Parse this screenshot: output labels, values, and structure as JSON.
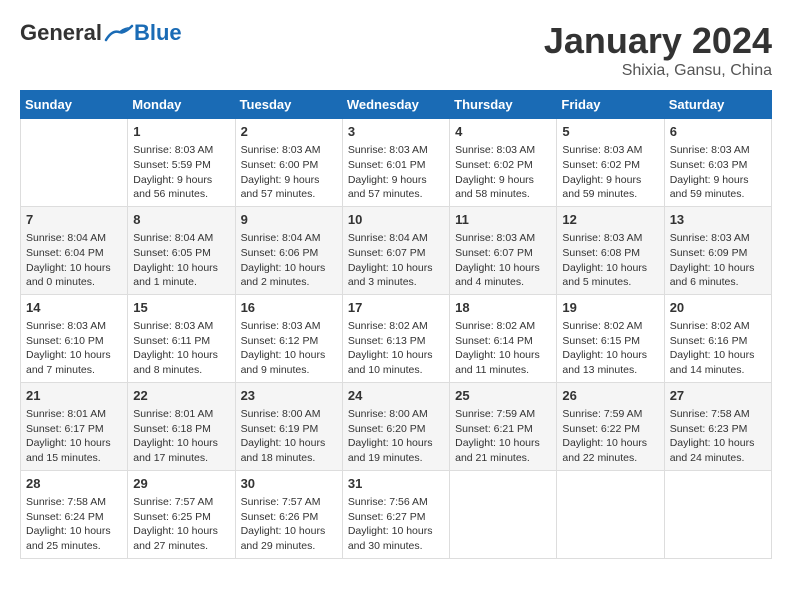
{
  "logo": {
    "general": "General",
    "blue": "Blue"
  },
  "title": "January 2024",
  "subtitle": "Shixia, Gansu, China",
  "days_of_week": [
    "Sunday",
    "Monday",
    "Tuesday",
    "Wednesday",
    "Thursday",
    "Friday",
    "Saturday"
  ],
  "weeks": [
    [
      {
        "day": "",
        "info": ""
      },
      {
        "day": "1",
        "info": "Sunrise: 8:03 AM\nSunset: 5:59 PM\nDaylight: 9 hours\nand 56 minutes."
      },
      {
        "day": "2",
        "info": "Sunrise: 8:03 AM\nSunset: 6:00 PM\nDaylight: 9 hours\nand 57 minutes."
      },
      {
        "day": "3",
        "info": "Sunrise: 8:03 AM\nSunset: 6:01 PM\nDaylight: 9 hours\nand 57 minutes."
      },
      {
        "day": "4",
        "info": "Sunrise: 8:03 AM\nSunset: 6:02 PM\nDaylight: 9 hours\nand 58 minutes."
      },
      {
        "day": "5",
        "info": "Sunrise: 8:03 AM\nSunset: 6:02 PM\nDaylight: 9 hours\nand 59 minutes."
      },
      {
        "day": "6",
        "info": "Sunrise: 8:03 AM\nSunset: 6:03 PM\nDaylight: 9 hours\nand 59 minutes."
      }
    ],
    [
      {
        "day": "7",
        "info": "Sunrise: 8:04 AM\nSunset: 6:04 PM\nDaylight: 10 hours\nand 0 minutes."
      },
      {
        "day": "8",
        "info": "Sunrise: 8:04 AM\nSunset: 6:05 PM\nDaylight: 10 hours\nand 1 minute."
      },
      {
        "day": "9",
        "info": "Sunrise: 8:04 AM\nSunset: 6:06 PM\nDaylight: 10 hours\nand 2 minutes."
      },
      {
        "day": "10",
        "info": "Sunrise: 8:04 AM\nSunset: 6:07 PM\nDaylight: 10 hours\nand 3 minutes."
      },
      {
        "day": "11",
        "info": "Sunrise: 8:03 AM\nSunset: 6:07 PM\nDaylight: 10 hours\nand 4 minutes."
      },
      {
        "day": "12",
        "info": "Sunrise: 8:03 AM\nSunset: 6:08 PM\nDaylight: 10 hours\nand 5 minutes."
      },
      {
        "day": "13",
        "info": "Sunrise: 8:03 AM\nSunset: 6:09 PM\nDaylight: 10 hours\nand 6 minutes."
      }
    ],
    [
      {
        "day": "14",
        "info": "Sunrise: 8:03 AM\nSunset: 6:10 PM\nDaylight: 10 hours\nand 7 minutes."
      },
      {
        "day": "15",
        "info": "Sunrise: 8:03 AM\nSunset: 6:11 PM\nDaylight: 10 hours\nand 8 minutes."
      },
      {
        "day": "16",
        "info": "Sunrise: 8:03 AM\nSunset: 6:12 PM\nDaylight: 10 hours\nand 9 minutes."
      },
      {
        "day": "17",
        "info": "Sunrise: 8:02 AM\nSunset: 6:13 PM\nDaylight: 10 hours\nand 10 minutes."
      },
      {
        "day": "18",
        "info": "Sunrise: 8:02 AM\nSunset: 6:14 PM\nDaylight: 10 hours\nand 11 minutes."
      },
      {
        "day": "19",
        "info": "Sunrise: 8:02 AM\nSunset: 6:15 PM\nDaylight: 10 hours\nand 13 minutes."
      },
      {
        "day": "20",
        "info": "Sunrise: 8:02 AM\nSunset: 6:16 PM\nDaylight: 10 hours\nand 14 minutes."
      }
    ],
    [
      {
        "day": "21",
        "info": "Sunrise: 8:01 AM\nSunset: 6:17 PM\nDaylight: 10 hours\nand 15 minutes."
      },
      {
        "day": "22",
        "info": "Sunrise: 8:01 AM\nSunset: 6:18 PM\nDaylight: 10 hours\nand 17 minutes."
      },
      {
        "day": "23",
        "info": "Sunrise: 8:00 AM\nSunset: 6:19 PM\nDaylight: 10 hours\nand 18 minutes."
      },
      {
        "day": "24",
        "info": "Sunrise: 8:00 AM\nSunset: 6:20 PM\nDaylight: 10 hours\nand 19 minutes."
      },
      {
        "day": "25",
        "info": "Sunrise: 7:59 AM\nSunset: 6:21 PM\nDaylight: 10 hours\nand 21 minutes."
      },
      {
        "day": "26",
        "info": "Sunrise: 7:59 AM\nSunset: 6:22 PM\nDaylight: 10 hours\nand 22 minutes."
      },
      {
        "day": "27",
        "info": "Sunrise: 7:58 AM\nSunset: 6:23 PM\nDaylight: 10 hours\nand 24 minutes."
      }
    ],
    [
      {
        "day": "28",
        "info": "Sunrise: 7:58 AM\nSunset: 6:24 PM\nDaylight: 10 hours\nand 25 minutes."
      },
      {
        "day": "29",
        "info": "Sunrise: 7:57 AM\nSunset: 6:25 PM\nDaylight: 10 hours\nand 27 minutes."
      },
      {
        "day": "30",
        "info": "Sunrise: 7:57 AM\nSunset: 6:26 PM\nDaylight: 10 hours\nand 29 minutes."
      },
      {
        "day": "31",
        "info": "Sunrise: 7:56 AM\nSunset: 6:27 PM\nDaylight: 10 hours\nand 30 minutes."
      },
      {
        "day": "",
        "info": ""
      },
      {
        "day": "",
        "info": ""
      },
      {
        "day": "",
        "info": ""
      }
    ]
  ]
}
